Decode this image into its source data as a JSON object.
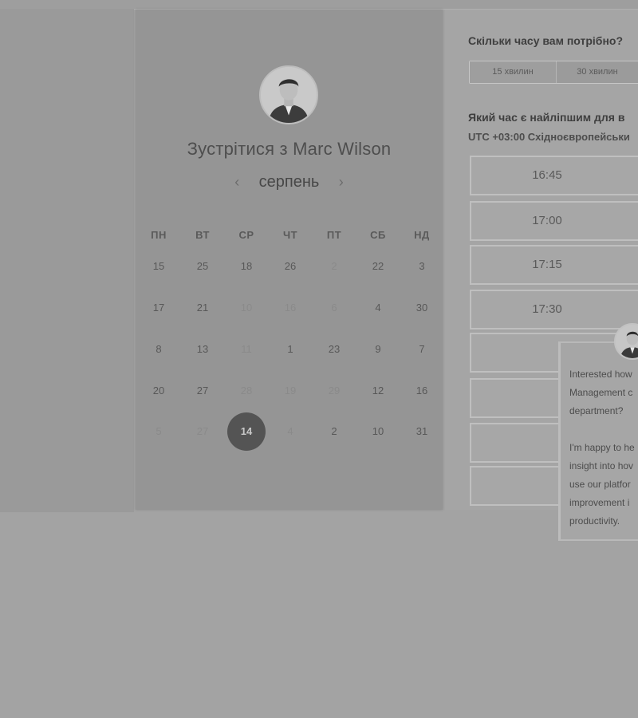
{
  "calendar": {
    "title": "Зустрітися з Marc Wilson",
    "month": "серпень",
    "prev_icon": "chevron-left-icon",
    "next_icon": "chevron-right-icon",
    "weekdays": [
      "ПН",
      "ВТ",
      "СР",
      "ЧТ",
      "ПТ",
      "СБ",
      "НД"
    ],
    "weeks": [
      [
        "15",
        "25",
        "18",
        "26",
        "2",
        "22",
        "3"
      ],
      [
        "17",
        "21",
        "10",
        "16",
        "6",
        "4",
        "30"
      ],
      [
        "8",
        "13",
        "11",
        "1",
        "23",
        "9",
        "7"
      ],
      [
        "20",
        "27",
        "28",
        "19",
        "29",
        "12",
        "16"
      ],
      [
        "5",
        "27",
        "14",
        "4",
        "2",
        "10",
        "31"
      ]
    ],
    "faded": [
      [
        0,
        4
      ],
      [
        1,
        2
      ],
      [
        1,
        3
      ],
      [
        1,
        4
      ],
      [
        2,
        2
      ],
      [
        3,
        2
      ],
      [
        3,
        3
      ],
      [
        3,
        4
      ],
      [
        4,
        0
      ],
      [
        4,
        1
      ],
      [
        4,
        3
      ]
    ],
    "selected": [
      4,
      2
    ]
  },
  "booking": {
    "duration_question": "Скільки часу вам потрібно?",
    "durations": [
      "15 хвилин",
      "30 хвилин"
    ],
    "time_question": "Який час є найліпшим для в",
    "timezone": "UTC +03:00 Східноєвропейськи",
    "slots": [
      "16:45",
      "17:00",
      "17:15",
      "17:30",
      "",
      "",
      "",
      ""
    ]
  },
  "chat": {
    "line1": "Interested how\nManagement c\ndepartment?",
    "line2": "I'm happy to he\ninsight into hov\nuse our platfor\nimprovement i\nproductivity."
  },
  "colors": {
    "selected_day": "#545454",
    "calendar_bg": "#959595",
    "page_bg": "#a3a3a3"
  }
}
